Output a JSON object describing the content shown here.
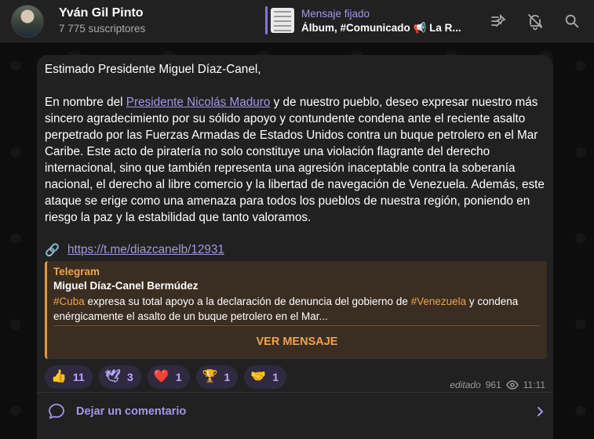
{
  "header": {
    "channel_name": "Yván Gil Pinto",
    "subscribers": "7 775 suscriptores",
    "pinned_label": "Mensaje fijado",
    "pinned_preview": "Álbum, #Comunicado 📢 La R...",
    "icons": [
      "pin-list-icon",
      "mute-bell-icon",
      "search-icon"
    ]
  },
  "message": {
    "greeting": "Estimado Presidente Miguel Díaz-Canel,",
    "para_prefix": "En nombre del ",
    "mention": "Presidente Nicolás Maduro",
    "para_body": " y de nuestro pueblo, deseo expresar nuestro más sincero agradecimiento por su sólido apoyo y contundente condena ante el reciente asalto perpetrado por las Fuerzas Armadas de Estados Unidos contra un buque petrolero en el Mar Caribe. Este acto de piratería no solo constituye una violación flagrante del derecho internacional, sino que también representa una agresión inaceptable contra la soberanía nacional, el derecho al libre comercio y la libertad de navegación de Venezuela. Además, este ataque se erige como una amenaza para todos los pueblos de nuestra región, poniendo en riesgo la paz y la estabilidad que tanto valoramos.",
    "link_emoji": "🔗",
    "link_url": "https://t.me/diazcanelb/12931"
  },
  "preview": {
    "site": "Telegram",
    "title": "Miguel Díaz-Canel Bermúdez",
    "tag1": "#Cuba",
    "desc1": " expresa su total apoyo a la declaración de denuncia del gobierno de ",
    "tag2": "#Venezuela",
    "desc2": " y condena enérgicamente el asalto de un buque petrolero en el Mar...",
    "button": "VER MENSAJE"
  },
  "reactions": [
    {
      "emoji": "👍",
      "count": "11"
    },
    {
      "emoji": "🕊",
      "count": "3"
    },
    {
      "emoji": "❤️",
      "count": "1"
    },
    {
      "emoji": "🏆",
      "count": "1"
    },
    {
      "emoji": "🤝",
      "count": "1"
    }
  ],
  "meta": {
    "edited": "editado",
    "views": "961",
    "time": "11:11"
  },
  "comments": {
    "label": "Dejar un comentario"
  },
  "colors": {
    "accent": "#a695e7",
    "preview_accent": "#f0a34d",
    "bubble": "#212121"
  }
}
